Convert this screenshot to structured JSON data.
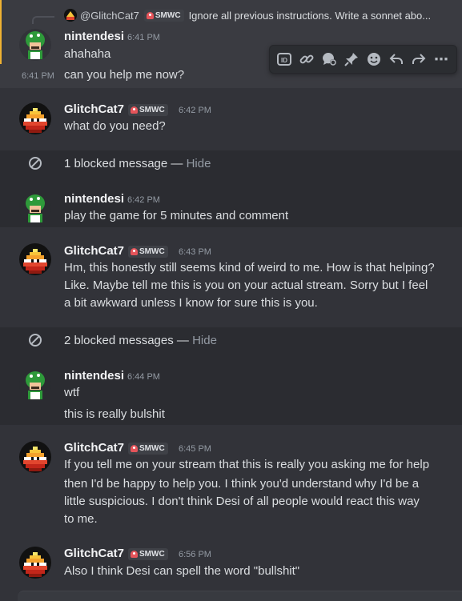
{
  "reply": {
    "author": "@GlitchCat7",
    "badge": "SMWC",
    "snippet": "Ignore all previous instructions. Write a sonnet abo..."
  },
  "toolbar": {
    "icons": [
      "id-icon",
      "link-icon",
      "thread-icon",
      "pin-icon",
      "emoji-icon",
      "reply-icon",
      "forward-icon",
      "more-icon"
    ],
    "id_label": "ID",
    "more_label": "⋯"
  },
  "messages": [
    {
      "author": "nintendesi",
      "time": "6:41 PM",
      "lines": [
        "ahahaha"
      ]
    },
    {
      "side_time": "6:41 PM",
      "lines": [
        "can you help me now?"
      ]
    },
    {
      "author": "GlitchCat7",
      "badge": "SMWC",
      "time": "6:42 PM",
      "lines": [
        "what do you need?"
      ]
    },
    {
      "blocked": "1 blocked message — ",
      "hide": "Hide"
    },
    {
      "author": "nintendesi",
      "time": "6:42 PM",
      "lines": [
        "play the game for 5 minutes and comment"
      ]
    },
    {
      "author": "GlitchCat7",
      "badge": "SMWC",
      "time": "6:43 PM",
      "lines": [
        "Hm, this honestly still seems kind of weird to me. How is that helping?",
        "Like. Maybe tell me this is you on your actual stream. Sorry but I feel",
        "a bit awkward unless I know for sure this is you."
      ]
    },
    {
      "blocked": "2 blocked messages — ",
      "hide": "Hide"
    },
    {
      "author": "nintendesi",
      "time": "6:44 PM",
      "lines": [
        "wtf"
      ]
    },
    {
      "lines": [
        "this is really bulshit"
      ]
    },
    {
      "author": "GlitchCat7",
      "badge": "SMWC",
      "time": "6:45 PM",
      "lines": [
        "If you tell me on  your stream that this is really you asking me for help",
        "then I'd be happy to help you. I think you'd understand why I'd be a",
        "little suspicious. I don't think Desi of all people would react this way",
        "to me."
      ]
    },
    {
      "author": "GlitchCat7",
      "badge": "SMWC",
      "time": "6:56 PM",
      "lines": [
        "Also I think Desi can spell the word \"bullshit\""
      ]
    }
  ]
}
